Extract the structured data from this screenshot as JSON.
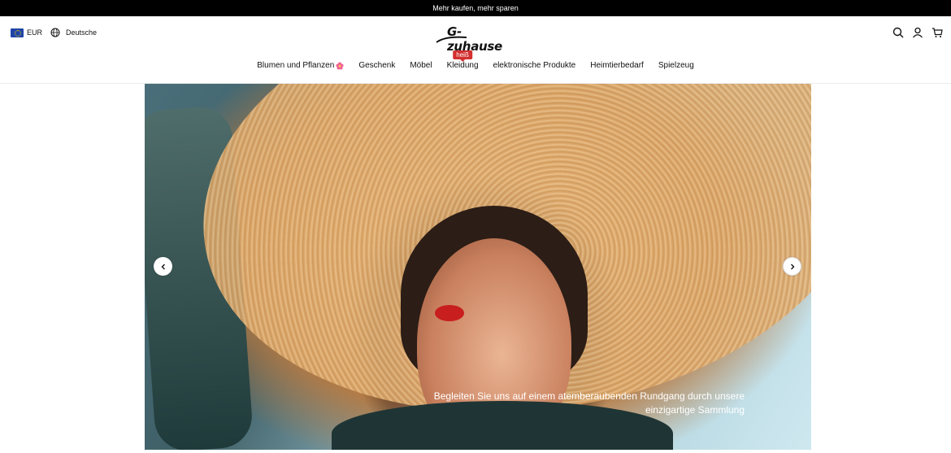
{
  "announcement": {
    "text": "Mehr kaufen, mehr sparen"
  },
  "header": {
    "currency": "EUR",
    "language": "Deutsche",
    "logo_text": "G-zuhause",
    "icons": [
      "search-icon",
      "user-icon",
      "cart-icon"
    ]
  },
  "nav": {
    "items": [
      {
        "label": "Blumen und Pflanzen"
      },
      {
        "label": "Geschenk"
      },
      {
        "label": "Möbel"
      },
      {
        "label": "Kleidung",
        "badge": "heiß"
      },
      {
        "label": "elektronische Produkte"
      },
      {
        "label": "Heimtierbedarf"
      },
      {
        "label": "Spielzeug"
      }
    ]
  },
  "hero": {
    "caption_line1": "Begleiten Sie uns auf einem atemberaubenden Rundgang durch unsere",
    "caption_line2": "einzigartige Sammlung",
    "prev_icon": "chevron-left-icon",
    "next_icon": "chevron-right-icon"
  },
  "colors": {
    "announcement_bg": "#000000",
    "badge": "#d32f2f"
  }
}
